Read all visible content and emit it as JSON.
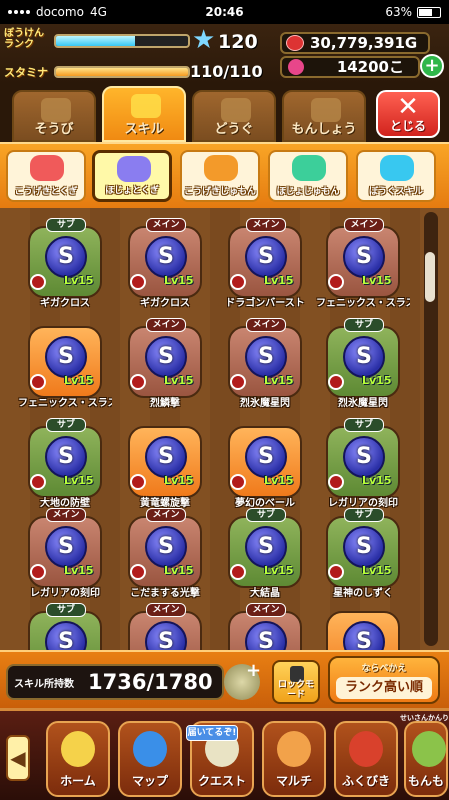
{
  "status": {
    "carrier": "docomo",
    "network": "4G",
    "time": "20:46",
    "battery": "63%"
  },
  "header": {
    "rank_label": "ぼうけんランク",
    "rank_value": "120",
    "rank_progress": 0.6,
    "stamina_label": "スタミナ",
    "stamina_value": "110/110",
    "stamina_progress": 1.0,
    "gold": "30,779,391G",
    "gems": "14200こ"
  },
  "tabs": [
    {
      "label": "そうび",
      "active": false
    },
    {
      "label": "スキル",
      "active": true
    },
    {
      "label": "どうぐ",
      "active": false
    },
    {
      "label": "もんしょう",
      "active": false
    }
  ],
  "close_label": "とじる",
  "subtabs": [
    {
      "label": "こうげきとくぎ",
      "color": "#f05a5a",
      "active": false
    },
    {
      "label": "ほじょとくぎ",
      "color": "#8a7df0",
      "active": true
    },
    {
      "label": "こうげきじゅもん",
      "color": "#f39a2a",
      "active": false
    },
    {
      "label": "ほじょじゅもん",
      "color": "#3ccf9a",
      "active": false
    },
    {
      "label": "ぼうぐスキル",
      "color": "#38c8f0",
      "active": false
    }
  ],
  "skills": [
    {
      "type": "サブ",
      "style": "sub",
      "level": "Lv15",
      "name": "ギガクロス"
    },
    {
      "type": "メイン",
      "style": "main",
      "level": "Lv15",
      "name": "ギガクロス"
    },
    {
      "type": "メイン",
      "style": "main",
      "level": "Lv15",
      "name": "ドラゴンバースト"
    },
    {
      "type": "メイン",
      "style": "main",
      "level": "Lv15",
      "name": "フェニックス・スラスト"
    },
    {
      "type": "",
      "style": "orange",
      "level": "Lv15",
      "name": "フェニックス・スラスト"
    },
    {
      "type": "メイン",
      "style": "main",
      "level": "Lv15",
      "name": "烈鱗撃"
    },
    {
      "type": "メイン",
      "style": "main",
      "level": "Lv15",
      "name": "烈氷魔星閃"
    },
    {
      "type": "サブ",
      "style": "sub",
      "level": "Lv15",
      "name": "烈氷魔星閃"
    },
    {
      "type": "サブ",
      "style": "sub",
      "level": "Lv15",
      "name": "大地の防壁"
    },
    {
      "type": "",
      "style": "orange",
      "level": "Lv15",
      "name": "黄竜螺旋撃"
    },
    {
      "type": "",
      "style": "orange",
      "level": "Lv15",
      "name": "夢幻のベール"
    },
    {
      "type": "サブ",
      "style": "sub",
      "level": "Lv15",
      "name": "レガリアの刻印"
    },
    {
      "type": "メイン",
      "style": "main",
      "level": "Lv15",
      "name": "レガリアの刻印"
    },
    {
      "type": "メイン",
      "style": "main",
      "level": "Lv15",
      "name": "こだまする光撃"
    },
    {
      "type": "サブ",
      "style": "sub",
      "level": "Lv15",
      "name": "大結晶"
    },
    {
      "type": "サブ",
      "style": "sub",
      "level": "Lv15",
      "name": "星神のしずく"
    },
    {
      "type": "サブ",
      "style": "sub",
      "level": "",
      "name": ""
    },
    {
      "type": "メイン",
      "style": "main",
      "level": "",
      "name": ""
    },
    {
      "type": "メイン",
      "style": "main",
      "level": "",
      "name": ""
    },
    {
      "type": "",
      "style": "orange",
      "level": "",
      "name": ""
    }
  ],
  "bottom": {
    "owned_label": "スキル所持数",
    "owned_value": "1736/1780",
    "lock_label": "ロックモード",
    "sort_small": "ならべかえ",
    "sort_label": "ランク高い順"
  },
  "nav": {
    "items": [
      "ホーム",
      "マップ",
      "クエスト",
      "マルチ",
      "ふくびき",
      "もんも"
    ],
    "quest_badge": "届いてるぞ!",
    "top_note": "せいさんかんり"
  }
}
